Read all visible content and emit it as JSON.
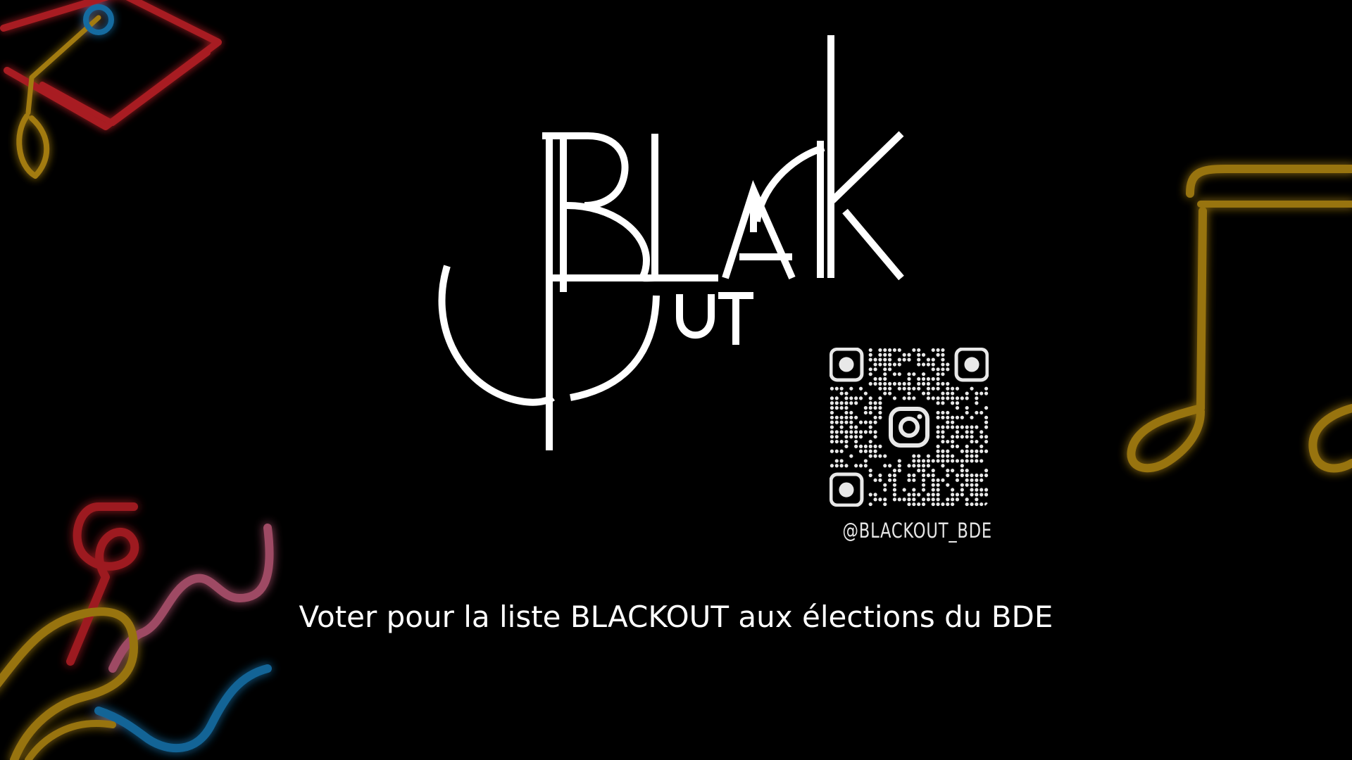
{
  "logo": {
    "text": "BLACKOUT",
    "color": "#ffffff"
  },
  "qr": {
    "handle": "@BLACKOUT_BDE",
    "center_icon": "instagram-icon",
    "module_color": "#e8e8e8"
  },
  "tagline": "Voter pour la liste BLACKOUT aux élections du BDE",
  "decorations": {
    "top_left": "graduation-cap-neon",
    "right": "music-note-neon",
    "bottom_left": "neon-squiggles",
    "colors": {
      "red": "#e0262d",
      "yellow": "#d9a514",
      "blue": "#1e8fd6",
      "pink": "#e16a8f"
    }
  }
}
